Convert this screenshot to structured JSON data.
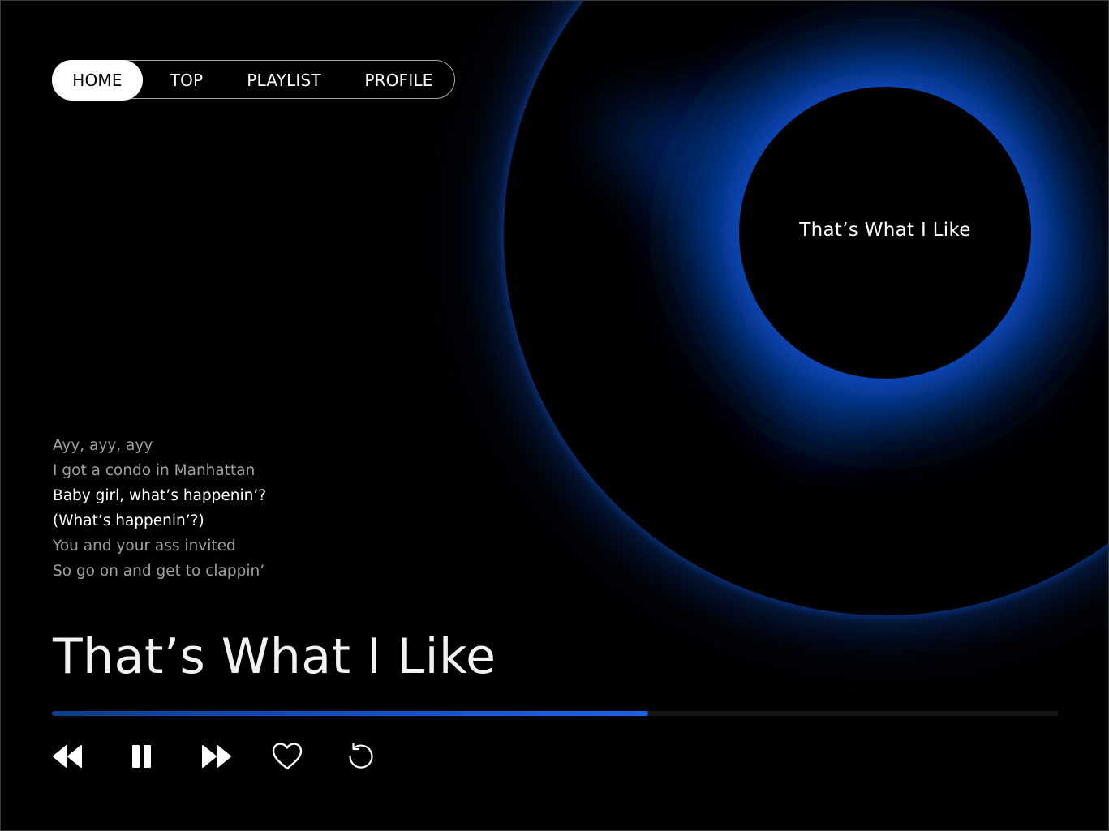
{
  "nav": {
    "items": [
      {
        "label": "HOME",
        "active": true
      },
      {
        "label": "TOP",
        "active": false
      },
      {
        "label": "PLAYLIST",
        "active": false
      },
      {
        "label": "PROFILE",
        "active": false
      }
    ]
  },
  "disc": {
    "label": "That’s What I Like"
  },
  "lyrics": [
    {
      "text": "Ayy, ayy, ayy",
      "current": false
    },
    {
      "text": "I got a condo in Manhattan",
      "current": false
    },
    {
      "text": "Baby girl, what’s happenin’?",
      "current": true
    },
    {
      "text": "(What’s happenin’?)",
      "current": true
    },
    {
      "text": "You and your ass invited",
      "current": false
    },
    {
      "text": "So go on and get to clappin’",
      "current": false
    }
  ],
  "song": {
    "title": "That’s What I Like"
  },
  "player": {
    "progress": 0.592
  },
  "controls": {
    "icons": [
      "rewind-icon",
      "pause-icon",
      "fast-forward-icon",
      "heart-icon",
      "repeat-icon"
    ]
  },
  "colors": {
    "background": "#000000",
    "accent": "#1157c4",
    "glow": "#0a4fc2"
  }
}
